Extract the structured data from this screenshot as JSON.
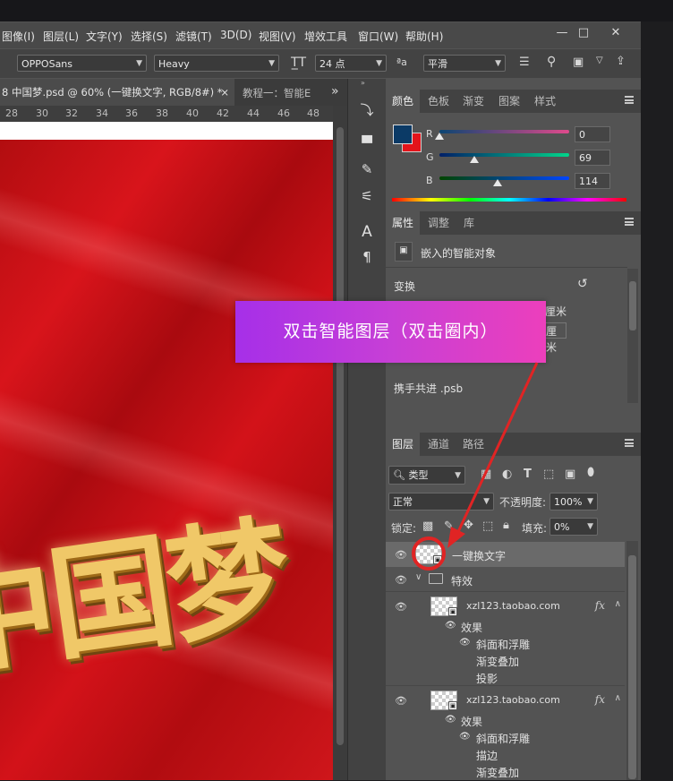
{
  "menu": [
    "图像(I)",
    "图层(L)",
    "文字(Y)",
    "选择(S)",
    "滤镜(T)",
    "3D(D)",
    "视图(V)",
    "增效工具",
    "窗口(W)",
    "帮助(H)"
  ],
  "window_controls": {
    "minimize": "—",
    "restore": "□",
    "close": "✕"
  },
  "options": {
    "font_family": "OPPOSans",
    "font_style": "Heavy",
    "font_size": "24 点",
    "antialias_label": "ªa",
    "antialias": "平滑"
  },
  "doc_tab": {
    "active": "8 中国梦.psd @ 60% (一键换文字, RGB/8#) *",
    "close": "×",
    "inactive": "教程一：智能E",
    "more": "»"
  },
  "ruler": [
    "28",
    "30",
    "32",
    "34",
    "36",
    "38",
    "40",
    "42",
    "44",
    "46",
    "48"
  ],
  "artwork_text": "中国梦",
  "color_panel": {
    "tabs": [
      "颜色",
      "色板",
      "渐变",
      "图案",
      "样式"
    ],
    "fg_color": "#0b3a66",
    "bg_color": "#e3141b",
    "channels": [
      {
        "label": "R",
        "value": "0",
        "level": 0.0
      },
      {
        "label": "G",
        "value": "69",
        "level": 0.27
      },
      {
        "label": "B",
        "value": "114",
        "level": 0.45
      }
    ]
  },
  "properties_panel": {
    "tabs": [
      "属性",
      "调整",
      "库"
    ],
    "object_type": "嵌入的智能对象",
    "transform_label": "变换",
    "unit_1": "厘米",
    "unit_2": "厘米",
    "linked_file": "携手共进 .psb"
  },
  "callout": "双击智能图层（双击圈内）",
  "layers_panel": {
    "tabs": [
      "图层",
      "通道",
      "路径"
    ],
    "filter_kind": "类型",
    "blend_mode": "正常",
    "opacity_label": "不透明度:",
    "opacity": "100%",
    "lock_label": "锁定:",
    "fill_label": "填充:",
    "fill": "0%",
    "layers": [
      {
        "name": "一键换文字"
      },
      {
        "name": "特效"
      },
      {
        "name": "xzl123.taobao.com",
        "fx": "fx",
        "effects_label": "效果",
        "effects": [
          "斜面和浮雕",
          "渐变叠加",
          "投影"
        ]
      },
      {
        "name": "xzl123.taobao.com",
        "fx": "fx",
        "effects_label": "效果",
        "effects": [
          "斜面和浮雕",
          "描边",
          "渐变叠加"
        ]
      }
    ]
  },
  "accent_color": "#e02424"
}
